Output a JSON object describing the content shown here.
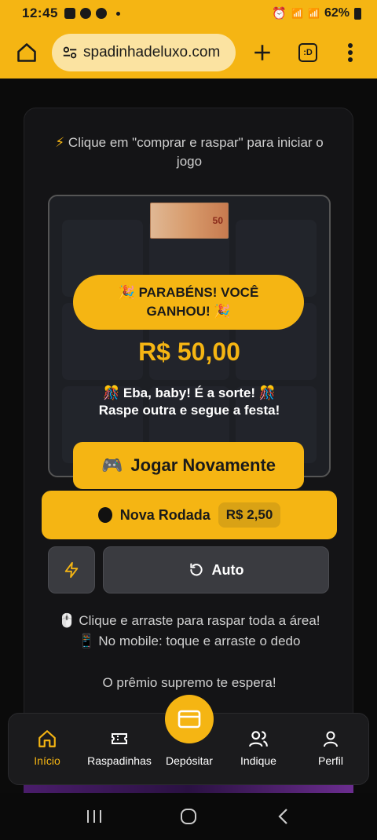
{
  "status_bar": {
    "time": "12:45",
    "battery": "62%",
    "network1": "VoB LTE1",
    "network2": "VoB LTE2"
  },
  "browser": {
    "url": "spadinhadeluxo.com",
    "tabs_label": ":D"
  },
  "game": {
    "hint": "Clique em \"comprar e raspar\" para iniciar o jogo",
    "hint_icon": "⚡",
    "prize_note": "50",
    "win_banner": "🎉 PARABÉNS! VOCÊ GANHOU! 🎉",
    "win_amount": "R$ 50,00",
    "cheer_line1": "🎊 Eba, baby! É a sorte! 🎊",
    "cheer_line2": "Raspe outra e segue a festa!",
    "play_again_icon": "🎮",
    "play_again": "Jogar Novamente",
    "new_round": "Nova Rodada",
    "new_round_price": "R$ 2,50",
    "auto": "Auto",
    "instr_line1": "🖱️ Clique e arraste para raspar toda a área!",
    "instr_line2": "📱 No mobile: toque e arraste o dedo",
    "supreme": "O prêmio supremo te espera!"
  },
  "bottom_nav": {
    "items": [
      {
        "label": "Início",
        "icon": "home-icon"
      },
      {
        "label": "Raspadinhas",
        "icon": "ticket-icon"
      },
      {
        "label": "Depósitar",
        "icon": "card-icon"
      },
      {
        "label": "Indique",
        "icon": "users-icon"
      },
      {
        "label": "Perfil",
        "icon": "user-icon"
      }
    ]
  },
  "colors": {
    "accent": "#f5b513",
    "background": "#0b0b0b",
    "card": "#141416",
    "button_dark": "#3a3b40"
  }
}
